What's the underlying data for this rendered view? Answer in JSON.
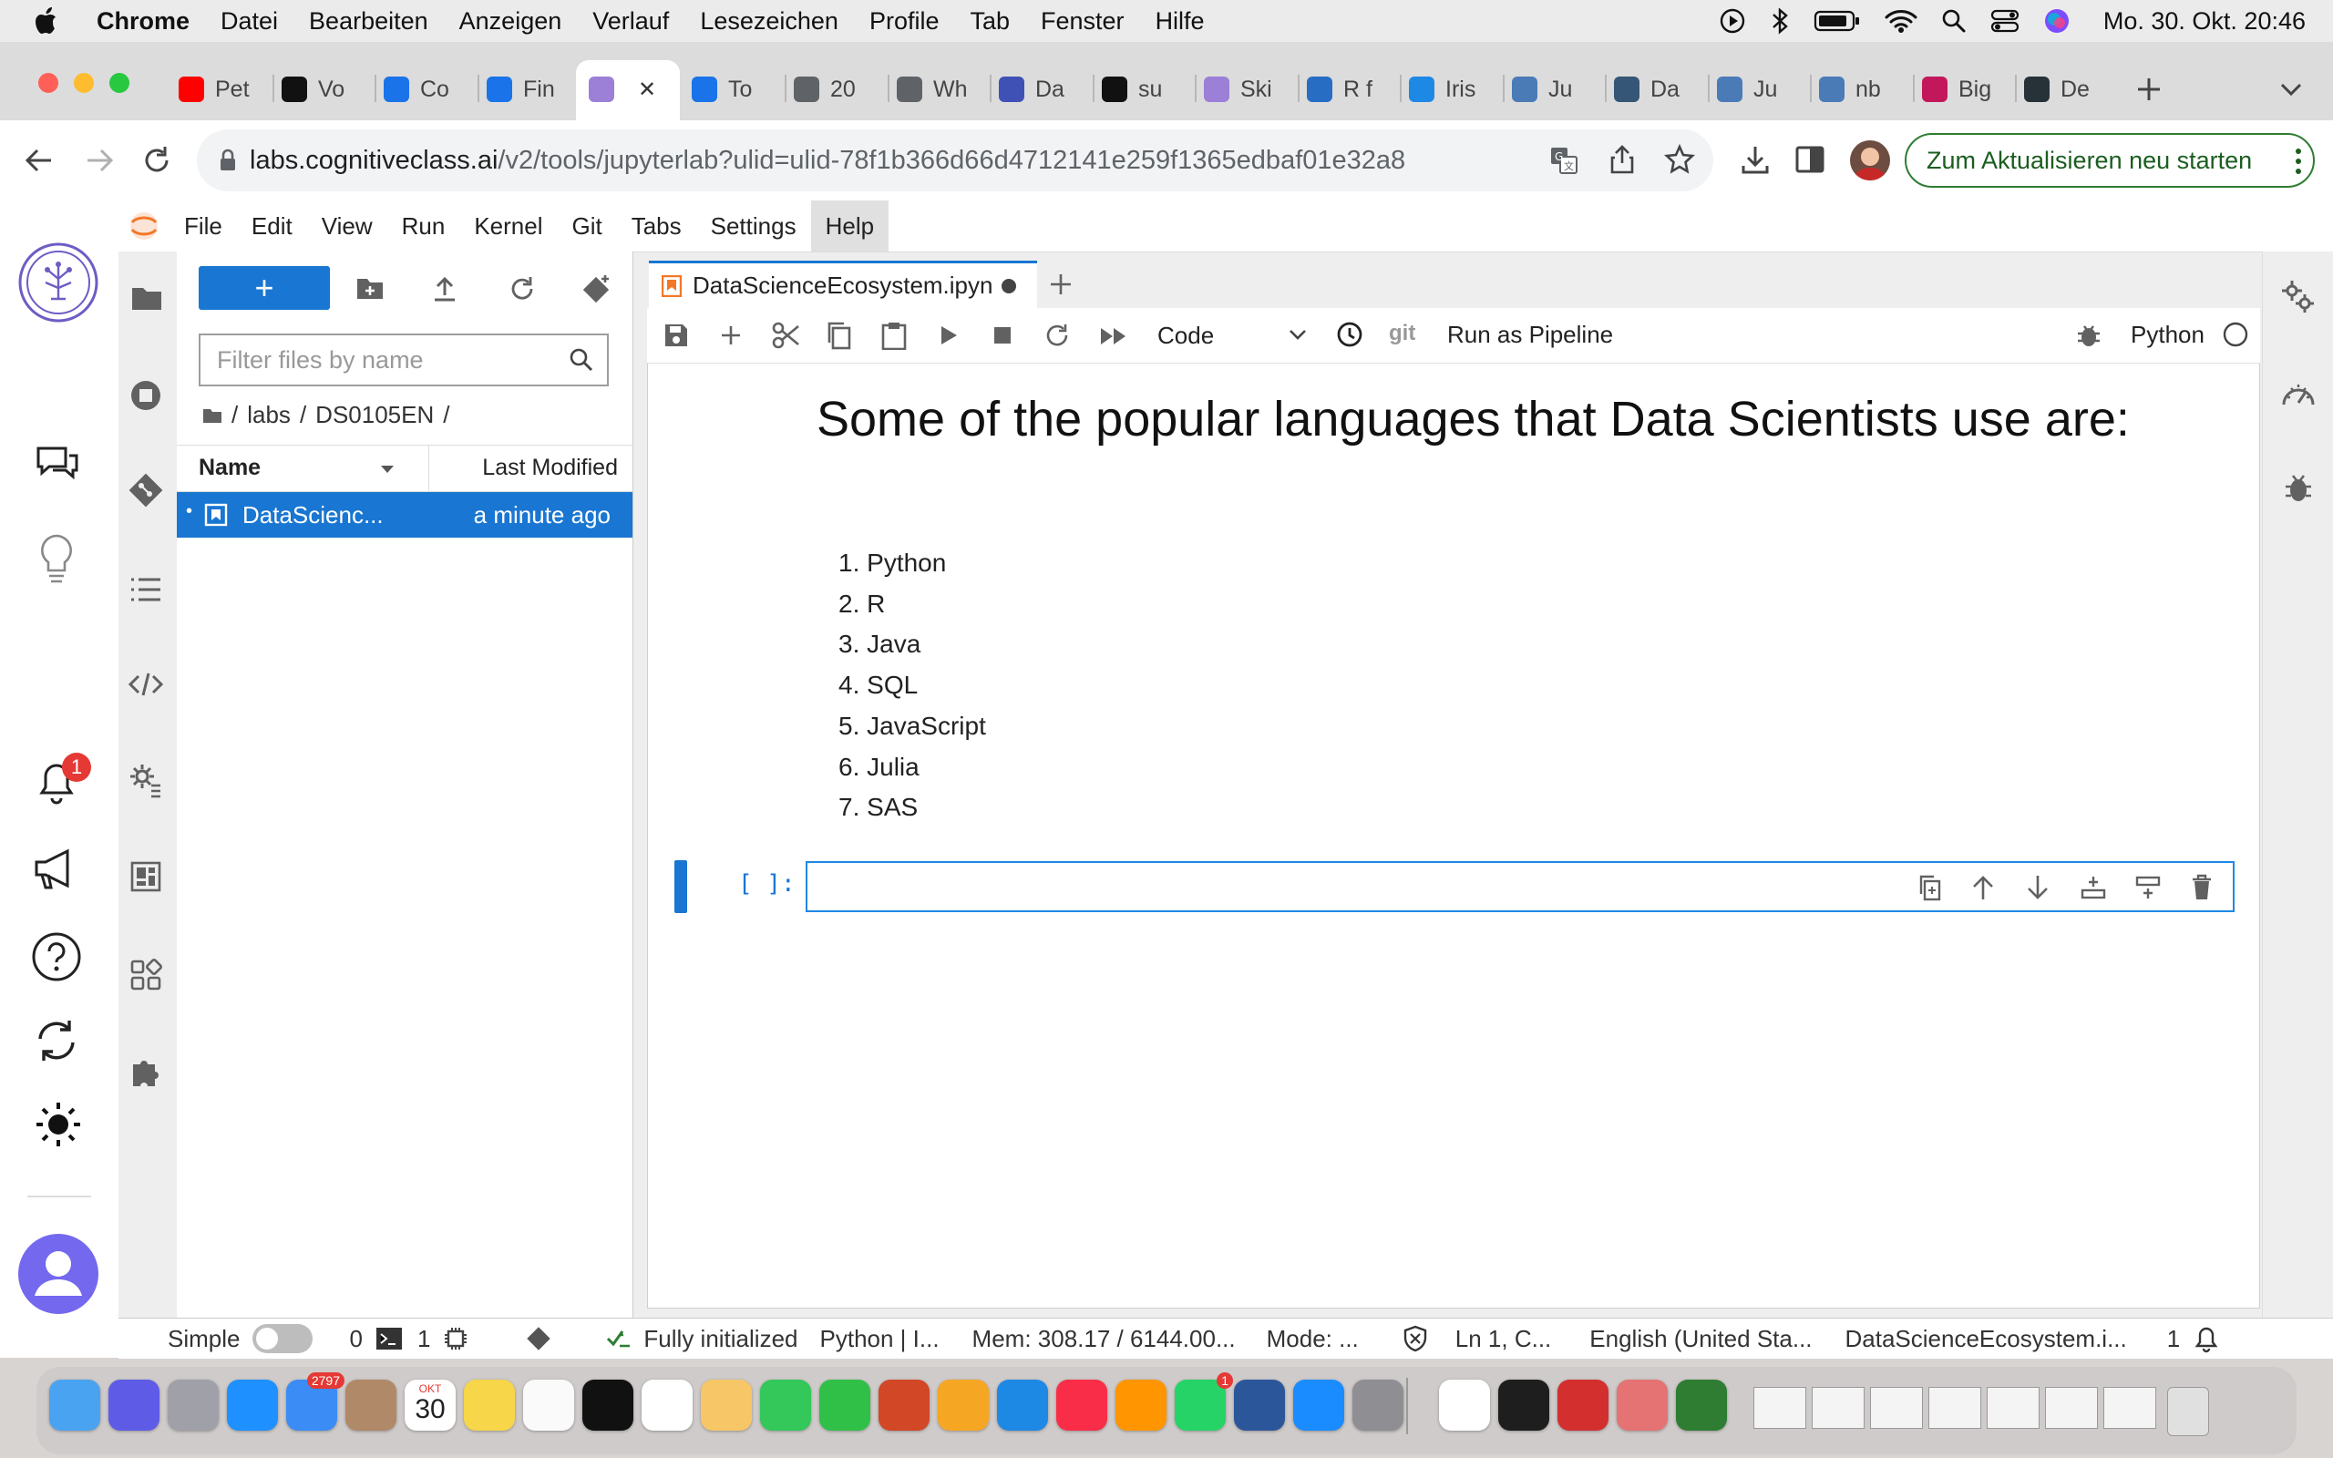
{
  "mac_menu": {
    "app": "Chrome",
    "items": [
      "Datei",
      "Bearbeiten",
      "Anzeigen",
      "Verlauf",
      "Lesezeichen",
      "Profile",
      "Tab",
      "Fenster",
      "Hilfe"
    ],
    "clock": "Mo. 30. Okt.  20:46"
  },
  "browser": {
    "tabs": [
      {
        "label": "Pet",
        "icon": "youtube-icon",
        "color": "#ff0000"
      },
      {
        "label": "Vo",
        "icon": "kaggle-like-icon",
        "color": "#111111"
      },
      {
        "label": "Co",
        "icon": "coursera-icon",
        "color": "#1a73e8"
      },
      {
        "label": "Fin",
        "icon": "coursera-icon",
        "color": "#1a73e8"
      },
      {
        "label": "",
        "icon": "jupyter-icon",
        "color": "#9c7fd6"
      },
      {
        "label": "To",
        "icon": "coursera-icon",
        "color": "#1a73e8"
      },
      {
        "label": "20",
        "icon": "globe-icon",
        "color": "#5f6368"
      },
      {
        "label": "Wh",
        "icon": "globe-icon",
        "color": "#5f6368"
      },
      {
        "label": "Da",
        "icon": "play-icon",
        "color": "#3f51b5"
      },
      {
        "label": "su",
        "icon": "github-icon",
        "color": "#111111"
      },
      {
        "label": "Ski",
        "icon": "jupyter-icon",
        "color": "#9c7fd6"
      },
      {
        "label": "R f",
        "icon": "r-icon",
        "color": "#276dc3"
      },
      {
        "label": "Iris",
        "icon": "k-icon",
        "color": "#1e88e5"
      },
      {
        "label": "Ju",
        "icon": "nb-icon",
        "color": "#4a7bb7"
      },
      {
        "label": "Da",
        "icon": "tds-icon",
        "color": "#355677"
      },
      {
        "label": "Ju",
        "icon": "nb-icon",
        "color": "#4a7bb7"
      },
      {
        "label": "nb",
        "icon": "nb-icon",
        "color": "#4a7bb7"
      },
      {
        "label": "Big",
        "icon": "bigquery-icon",
        "color": "#c2185b"
      },
      {
        "label": "De",
        "icon": "dev-icon",
        "color": "#263238"
      }
    ],
    "url_host": "labs.cognitiveclass.ai",
    "url_path": "/v2/tools/jupyterlab?ulid=ulid-78f1b366d66d4712141e259f1365edbaf01e32a8",
    "update_button": "Zum Aktualisieren neu starten"
  },
  "jupyter": {
    "menu": [
      "File",
      "Edit",
      "View",
      "Run",
      "Kernel",
      "Git",
      "Tabs",
      "Settings",
      "Help"
    ],
    "active_menu": "Help",
    "filebrowser": {
      "new_label": "+",
      "filter_placeholder": "Filter files by name",
      "breadcrumb": [
        "labs",
        "DS0105EN"
      ],
      "col_name": "Name",
      "col_modified": "Last Modified",
      "files": [
        {
          "name": "DataScienc...",
          "modified": "a minute ago"
        }
      ]
    },
    "doc_tab": "DataScienceEcosystem.ipyn",
    "notebook_toolbar": {
      "cell_type": "Code",
      "git": "git",
      "pipeline": "Run as Pipeline",
      "kernel": "Python"
    },
    "markdown": {
      "heading": "Some of the popular languages that Data Scientists use are:",
      "items": [
        "Python",
        "R",
        "Java",
        "SQL",
        "JavaScript",
        "Julia",
        "SAS"
      ]
    },
    "code_cell": {
      "prompt": "[ ]:"
    },
    "statusbar": {
      "mode_label": "Simple",
      "count1": "0",
      "count2": "1",
      "kernel_status": "Fully initialized",
      "kernel": "Python | I...",
      "memory": "Mem: 308.17 / 6144.00...",
      "mode": "Mode: ...",
      "position": "Ln 1, C...",
      "language": "English (United Sta...",
      "file": "DataScienceEcosystem.i...",
      "notifications": "1"
    },
    "leftbar": {
      "notification_count": "1"
    }
  },
  "dock": {
    "mail_badge": "2797",
    "calendar_month": "OKT",
    "calendar_day": "30",
    "whatsapp_badge": "1"
  }
}
